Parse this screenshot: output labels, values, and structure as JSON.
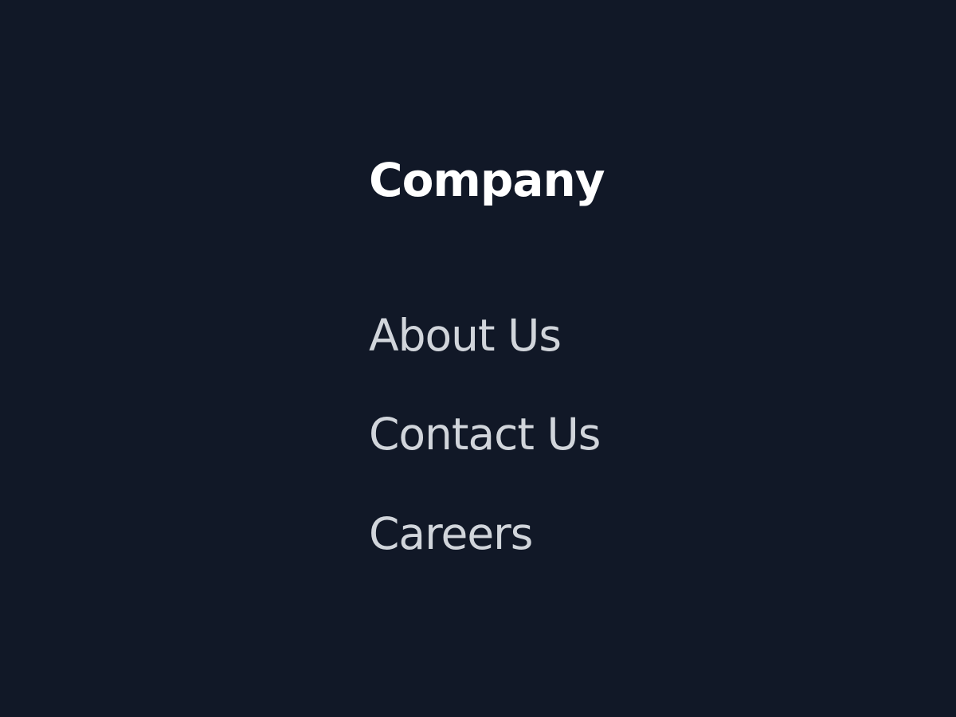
{
  "footer": {
    "heading": "Company",
    "links": [
      {
        "label": "About Us"
      },
      {
        "label": "Contact Us"
      },
      {
        "label": "Careers"
      }
    ]
  },
  "colors": {
    "background": "#111827",
    "heading": "#ffffff",
    "link": "#d1d5db"
  }
}
